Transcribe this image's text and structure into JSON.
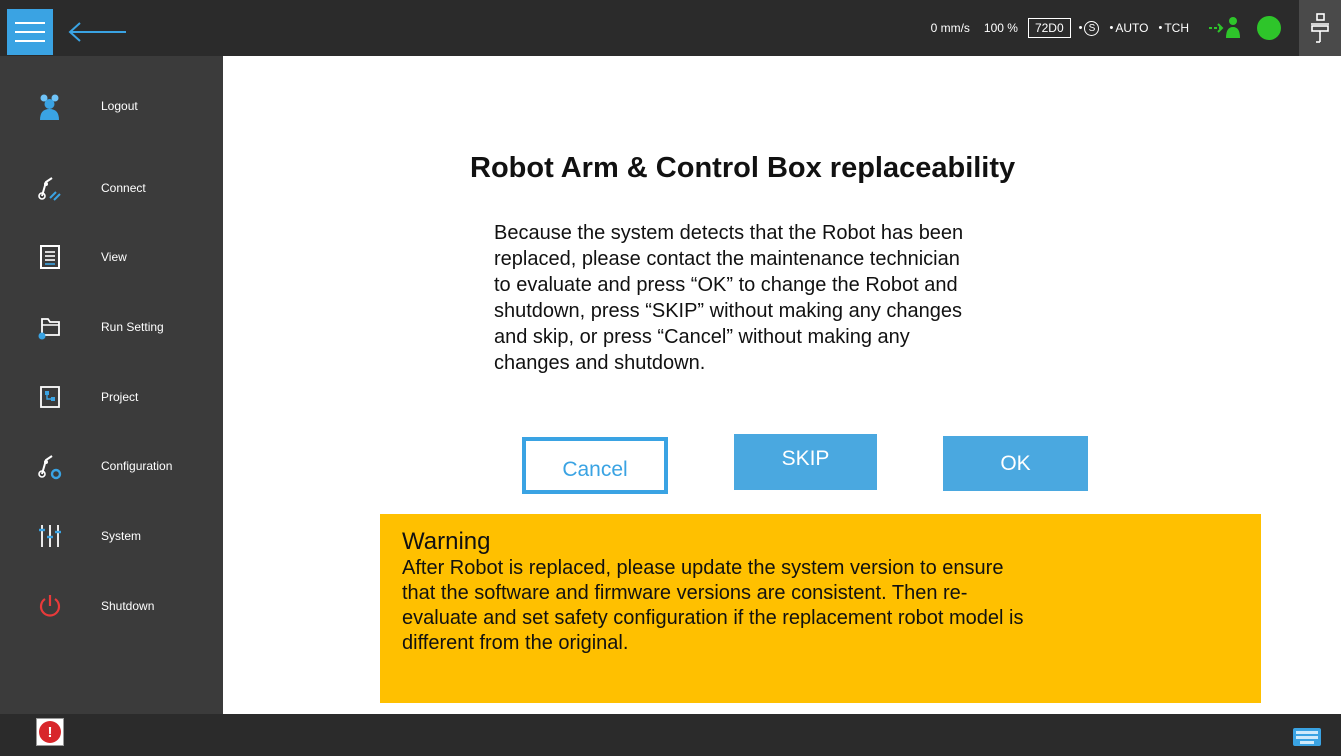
{
  "topbar": {
    "speed": "0 mm/s",
    "percent": "100 %",
    "code": "72D0",
    "s_mode": "S",
    "auto": "AUTO",
    "tch": "TCH",
    "colors": {
      "accent": "#3aa3e3",
      "status_green": "#2ec52a"
    }
  },
  "sidebar": {
    "items": [
      {
        "label": "Logout",
        "icon": "users-icon"
      },
      {
        "label": "Connect",
        "icon": "connect-icon"
      },
      {
        "label": "View",
        "icon": "view-icon"
      },
      {
        "label": "Run Setting",
        "icon": "run-setting-icon"
      },
      {
        "label": "Project",
        "icon": "project-icon"
      },
      {
        "label": "Configuration",
        "icon": "configuration-icon"
      },
      {
        "label": "System",
        "icon": "sliders-icon"
      },
      {
        "label": "Shutdown",
        "icon": "power-icon"
      }
    ]
  },
  "dialog": {
    "title": "Robot Arm & Control Box replaceability",
    "message": "Because the system detects that the Robot has been\nreplaced, please contact the maintenance technician\nto evaluate and press “OK” to change the Robot and\nshutdown, press “SKIP” without making any changes\nand skip, or press “Cancel” without making any\nchanges and shutdown.",
    "buttons": {
      "cancel": "Cancel",
      "skip": "SKIP",
      "ok": "OK"
    }
  },
  "warning": {
    "title": "Warning",
    "text": "After Robot is replaced, please update the system version to ensure\nthat the software and firmware versions are consistent. Then re-\nevaluate and set safety configuration if the replacement robot model is\ndifferent from the original.",
    "color": "#ffc000"
  },
  "bottombar": {
    "alert_icon": "alert-icon",
    "keyboard_icon": "keyboard-icon"
  }
}
